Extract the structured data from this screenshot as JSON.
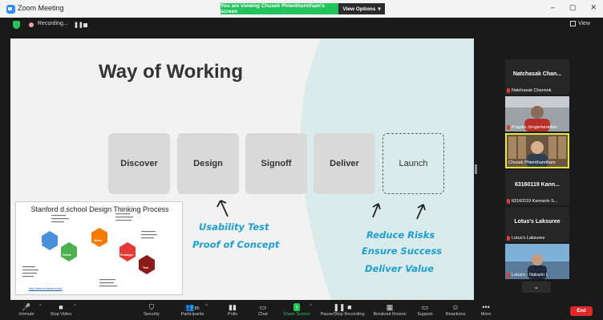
{
  "window": {
    "title": "Zoom Meeting",
    "share_banner": "You are viewing Chusek Phienthamtham's screen",
    "view_options": "View Options"
  },
  "status": {
    "recording": "Recording...",
    "view": "View"
  },
  "slide": {
    "title": "Way of Working",
    "phases": [
      "Discover",
      "Design",
      "Signoff",
      "Deliver",
      "Launch"
    ],
    "notes_left": [
      "Usability Test",
      "Proof of Concept"
    ],
    "notes_right": [
      "Reduce Risks",
      "Ensure Success",
      "Deliver Value"
    ],
    "dt_title": "Stanford d.school Design Thinking Process",
    "dt_hex": [
      "Empathize",
      "Define",
      "Ideate",
      "Prototype",
      "Test"
    ],
    "dt_link": "http://dschool.stanford.edu"
  },
  "participants": [
    {
      "name": "Natchasak Chan...",
      "label": "Natchasak Channok",
      "video": false
    },
    {
      "name": "",
      "label": "Prajaks Jirngemeradan",
      "video": true
    },
    {
      "name": "",
      "label": "Chusek Phienthamtham",
      "video": true,
      "active": true
    },
    {
      "name": "63160119 Kann...",
      "label": "63160119 Kannarin S...",
      "video": false
    },
    {
      "name": "Lotus's Laksuree",
      "label": "Lotus's Laksuree",
      "video": false
    },
    {
      "name": "",
      "label": "Lotus's - Nakarin L",
      "video": true
    }
  ],
  "toolbar": {
    "unmute": "Unmute",
    "stop_video": "Stop Video",
    "security": "Security",
    "participants": "Participants",
    "participants_count": "85",
    "polls": "Polls",
    "chat": "Chat",
    "share_screen": "Share Screen",
    "recording": "Pause/Stop Recording",
    "breakout": "Breakout Rooms",
    "support": "Support",
    "reactions": "Reactions",
    "more": "More",
    "end": "End"
  },
  "colors": {
    "share_green": "#23c45e",
    "end_red": "#e02828",
    "accent_blue": "#1e9ed6"
  }
}
